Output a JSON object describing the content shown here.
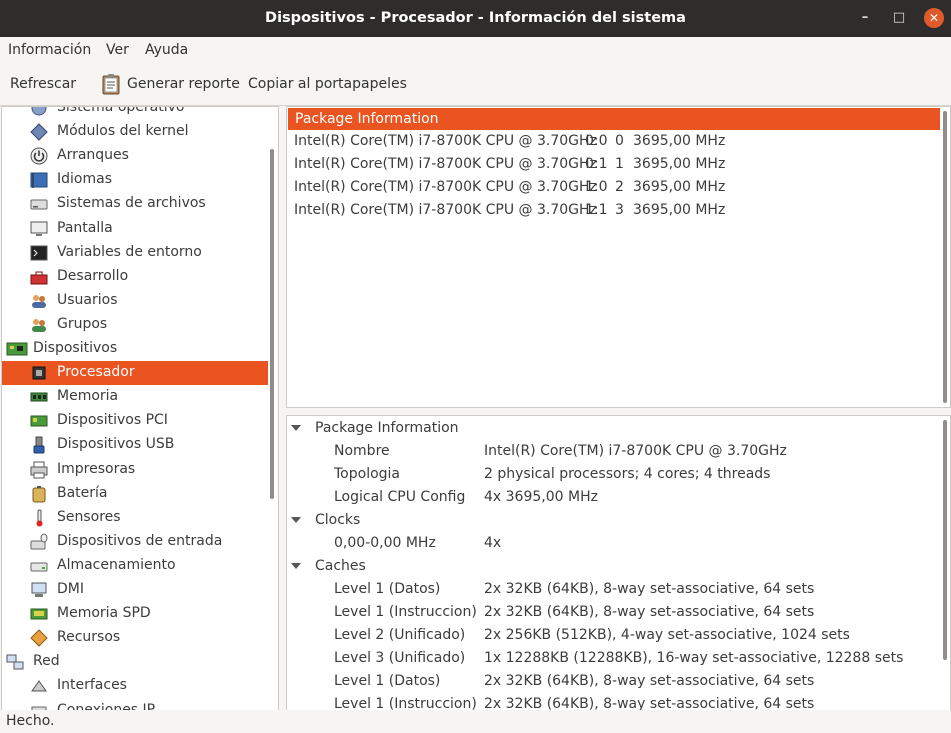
{
  "window": {
    "title": "Dispositivos - Procesador - Información del sistema",
    "minimize": "–",
    "maximize": "□",
    "close": "✕"
  },
  "menu": {
    "items": [
      "Información",
      "Ver",
      "Ayuda"
    ]
  },
  "toolbar": {
    "refresh": "Refrescar",
    "report": "Generar reporte",
    "copy": "Copiar al portapapeles"
  },
  "sidebar": {
    "items": [
      {
        "label": "Sistema operativo",
        "icon": "os-icon",
        "level": 1
      },
      {
        "label": "Módulos del kernel",
        "icon": "kernel-module-icon",
        "level": 1
      },
      {
        "label": "Arranques",
        "icon": "power-icon",
        "level": 1
      },
      {
        "label": "Idiomas",
        "icon": "language-flag-icon",
        "level": 1
      },
      {
        "label": "Sistemas de archivos",
        "icon": "drive-icon",
        "level": 1
      },
      {
        "label": "Pantalla",
        "icon": "display-icon",
        "level": 1
      },
      {
        "label": "Variables de entorno",
        "icon": "terminal-icon",
        "level": 1
      },
      {
        "label": "Desarrollo",
        "icon": "toolbox-icon",
        "level": 1
      },
      {
        "label": "Usuarios",
        "icon": "users-icon",
        "level": 1
      },
      {
        "label": "Grupos",
        "icon": "groups-icon",
        "level": 1
      },
      {
        "label": "Dispositivos",
        "icon": "board-icon",
        "level": 0
      },
      {
        "label": "Procesador",
        "icon": "cpu-icon",
        "level": 1,
        "selected": true
      },
      {
        "label": "Memoria",
        "icon": "memory-icon",
        "level": 1
      },
      {
        "label": "Dispositivos PCI",
        "icon": "pci-icon",
        "level": 1
      },
      {
        "label": "Dispositivos USB",
        "icon": "usb-icon",
        "level": 1
      },
      {
        "label": "Impresoras",
        "icon": "printer-icon",
        "level": 1
      },
      {
        "label": "Batería",
        "icon": "battery-icon",
        "level": 1
      },
      {
        "label": "Sensores",
        "icon": "thermometer-icon",
        "level": 1
      },
      {
        "label": "Dispositivos de entrada",
        "icon": "input-device-icon",
        "level": 1
      },
      {
        "label": "Almacenamiento",
        "icon": "storage-icon",
        "level": 1
      },
      {
        "label": "DMI",
        "icon": "dmi-icon",
        "level": 1
      },
      {
        "label": "Memoria SPD",
        "icon": "spd-icon",
        "level": 1
      },
      {
        "label": "Recursos",
        "icon": "resources-icon",
        "level": 1
      },
      {
        "label": "Red",
        "icon": "network-icon",
        "level": 0
      },
      {
        "label": "Interfaces",
        "icon": "interfaces-icon",
        "level": 1
      },
      {
        "label": "Conexiones IP",
        "icon": "ip-icon",
        "level": 1
      }
    ]
  },
  "cpu_list": {
    "header": "Package Information",
    "rows": [
      {
        "name": "Intel(R) Core(TM) i7-8700K CPU @ 3.70GHz",
        "topo": "0:0",
        "id": "0",
        "freq": "3695,00 MHz"
      },
      {
        "name": "Intel(R) Core(TM) i7-8700K CPU @ 3.70GHz",
        "topo": "0:1",
        "id": "1",
        "freq": "3695,00 MHz"
      },
      {
        "name": "Intel(R) Core(TM) i7-8700K CPU @ 3.70GHz",
        "topo": "1:0",
        "id": "2",
        "freq": "3695,00 MHz"
      },
      {
        "name": "Intel(R) Core(TM) i7-8700K CPU @ 3.70GHz",
        "topo": "1:1",
        "id": "3",
        "freq": "3695,00 MHz"
      }
    ]
  },
  "details": {
    "rows": [
      {
        "type": "section",
        "label": "Package Information"
      },
      {
        "type": "kv",
        "key": "Nombre",
        "value": "Intel(R) Core(TM) i7-8700K CPU @ 3.70GHz"
      },
      {
        "type": "kv",
        "key": "Topologia",
        "value": "2 physical processors; 4 cores; 4 threads"
      },
      {
        "type": "kv",
        "key": "Logical CPU Config",
        "value": "4x 3695,00 MHz"
      },
      {
        "type": "section",
        "label": "Clocks"
      },
      {
        "type": "kv",
        "key": "0,00-0,00 MHz",
        "value": "4x"
      },
      {
        "type": "section",
        "label": "Caches"
      },
      {
        "type": "kv",
        "key": "Level 1 (Datos)",
        "value": "2x 32KB (64KB), 8-way set-associative, 64 sets"
      },
      {
        "type": "kv",
        "key": "Level 1 (Instruccion)",
        "value": "2x 32KB (64KB), 8-way set-associative, 64 sets"
      },
      {
        "type": "kv",
        "key": "Level 2 (Unificado)",
        "value": "2x 256KB (512KB), 4-way set-associative, 1024 sets"
      },
      {
        "type": "kv",
        "key": "Level 3 (Unificado)",
        "value": "1x 12288KB (12288KB), 16-way set-associative, 12288 sets"
      },
      {
        "type": "kv",
        "key": "Level 1 (Datos)",
        "value": "2x 32KB (64KB), 8-way set-associative, 64 sets"
      },
      {
        "type": "kv",
        "key": "Level 1 (Instruccion)",
        "value": "2x 32KB (64KB), 8-way set-associative, 64 sets"
      }
    ]
  },
  "status": {
    "text": "Hecho."
  },
  "colors": {
    "accent": "#e95420",
    "titlebar": "#2e2d2c"
  }
}
